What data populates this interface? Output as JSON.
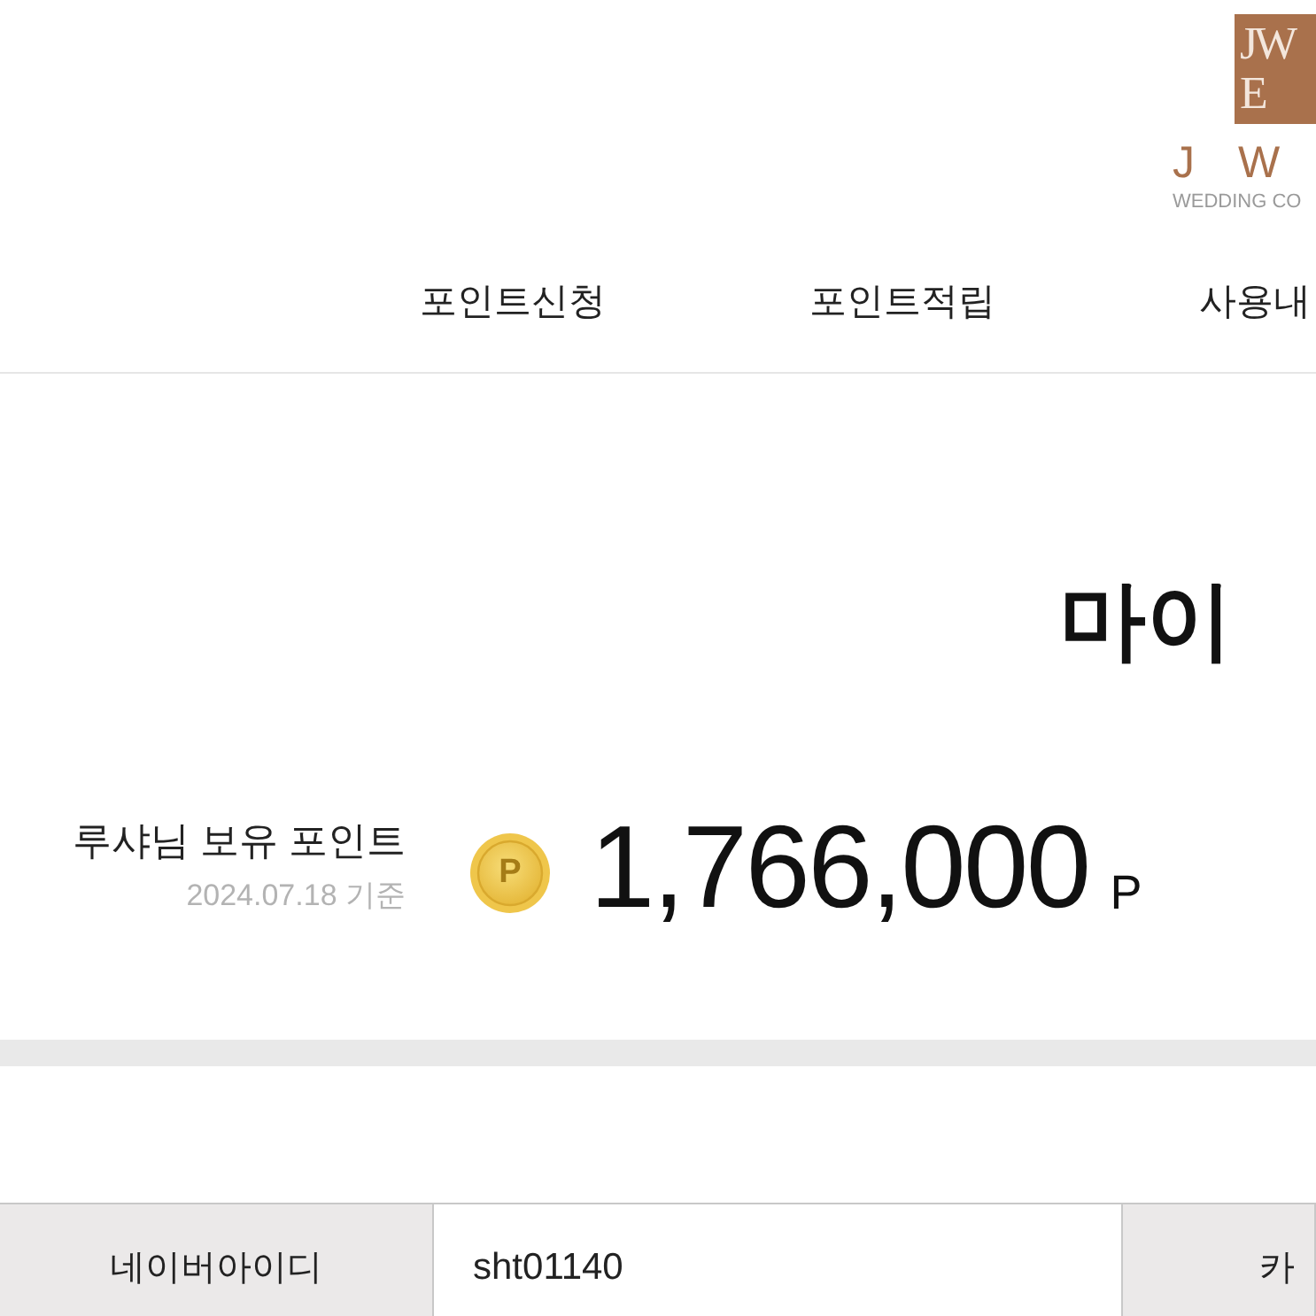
{
  "logo": {
    "monogram": [
      "JW",
      "E"
    ],
    "wordmark": "J W",
    "tagline": "WEDDING CO"
  },
  "nav": [
    {
      "label": "포인트신청"
    },
    {
      "label": "포인트적립"
    },
    {
      "label": "사용내"
    }
  ],
  "page_title": "마이",
  "points": {
    "owner_label": "루샤님 보유 포인트",
    "as_of": "2024.07.18 기준",
    "coin_label": "P",
    "amount": "1,766,000",
    "unit": "P"
  },
  "account_fields": [
    {
      "label": "네이버아이디",
      "value": "sht01140"
    },
    {
      "label": "카"
    }
  ]
}
